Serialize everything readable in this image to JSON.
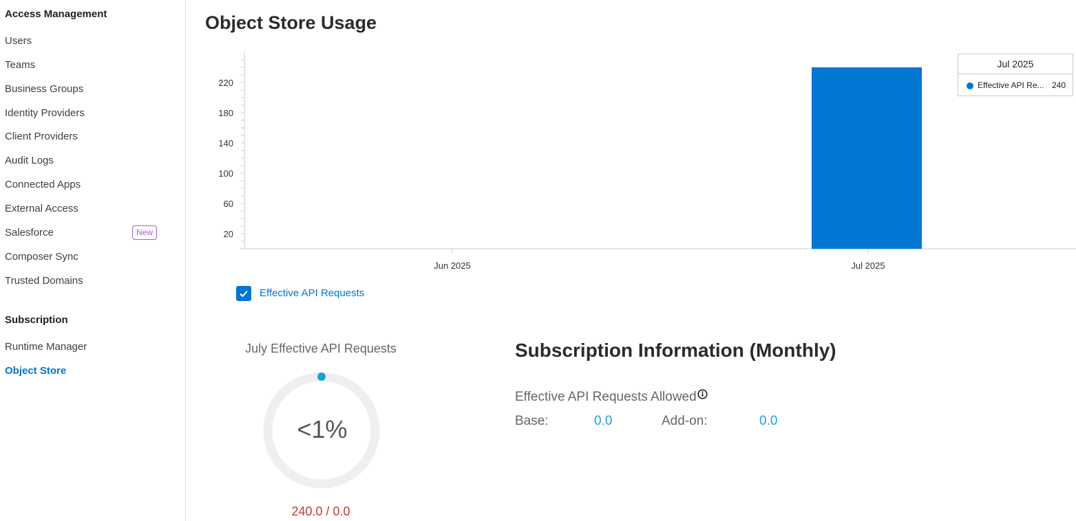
{
  "sidebar": {
    "sections": [
      {
        "title": "Access Management",
        "items": [
          {
            "label": "Users"
          },
          {
            "label": "Teams"
          },
          {
            "label": "Business Groups"
          },
          {
            "label": "Identity Providers"
          },
          {
            "label": "Client Providers"
          },
          {
            "label": "Audit Logs"
          },
          {
            "label": "Connected Apps"
          },
          {
            "label": "External Access"
          },
          {
            "label": "Salesforce",
            "badge": "New"
          },
          {
            "label": "Composer Sync"
          },
          {
            "label": "Trusted Domains"
          }
        ]
      },
      {
        "title": "Subscription",
        "items": [
          {
            "label": "Runtime Manager"
          },
          {
            "label": "Object Store",
            "active": true
          }
        ]
      }
    ]
  },
  "main": {
    "title": "Object Store Usage",
    "legend": {
      "label": "Effective API Requests",
      "checked": true
    },
    "tooltip": {
      "title": "Jul 2025",
      "series": "Effective API Re...",
      "value": "240"
    },
    "gauge": {
      "title": "July Effective API Requests",
      "value": "<1%",
      "fraction": 0.0,
      "footer": "240.0 / 0.0"
    },
    "subscription": {
      "title": "Subscription Information (Monthly)",
      "allowed_label": "Effective API Requests Allowed",
      "base_label": "Base:",
      "base_value": "0.0",
      "addon_label": "Add-on:",
      "addon_value": "0.0"
    }
  },
  "colors": {
    "accent": "#0176d3",
    "bar": "#0176d3",
    "badge": "#9b5de5",
    "gauge_dot": "#1ba1d9",
    "footer": "#c23934"
  },
  "chart_data": {
    "type": "bar",
    "categories": [
      "Jun 2025",
      "Jul 2025"
    ],
    "series": [
      {
        "name": "Effective API Requests",
        "values": [
          0,
          240
        ]
      }
    ],
    "yticks": [
      20,
      60,
      100,
      140,
      180,
      220
    ],
    "ylim": [
      0,
      260
    ],
    "grid": false,
    "legend": "bottom-left"
  }
}
